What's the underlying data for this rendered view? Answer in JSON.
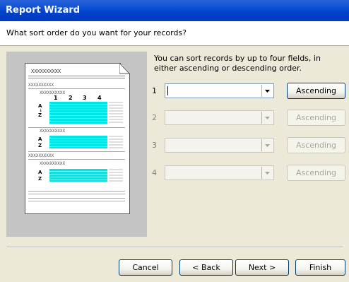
{
  "window": {
    "title": "Report Wizard"
  },
  "header": {
    "question": "What sort order do you want for your records?"
  },
  "info": {
    "text": "You can sort records by up to four fields, in either ascending or descending order."
  },
  "preview": {
    "placeholder": "XXXXXXXXXX",
    "group_columns": [
      "1",
      "2",
      "3",
      "4"
    ],
    "sort_glyph_top": "A",
    "sort_glyph_bottom": "Z"
  },
  "sort_rows": [
    {
      "number": "1",
      "field_value": "",
      "order_label": "Ascending",
      "enabled": true
    },
    {
      "number": "2",
      "field_value": "",
      "order_label": "Ascending",
      "enabled": false
    },
    {
      "number": "3",
      "field_value": "",
      "order_label": "Ascending",
      "enabled": false
    },
    {
      "number": "4",
      "field_value": "",
      "order_label": "Ascending",
      "enabled": false
    }
  ],
  "buttons": {
    "cancel": "Cancel",
    "back": "< Back",
    "next": "Next >",
    "finish": "Finish"
  },
  "colors": {
    "titlebar": "#0a4fd6",
    "preview_bg": "#c4c4c4",
    "cells": "#00e5e5"
  }
}
